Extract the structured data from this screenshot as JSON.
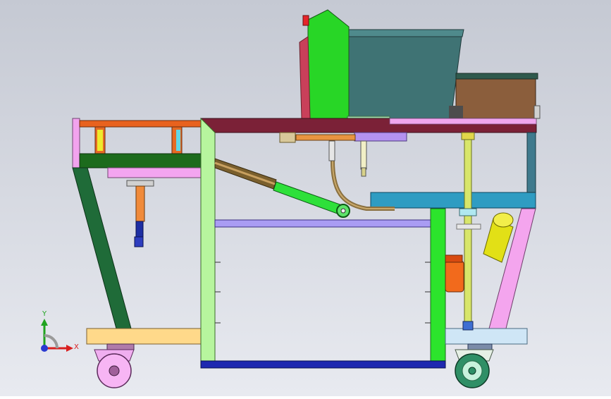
{
  "triad": {
    "x_label": "X",
    "y_label": "Y"
  },
  "colors": {
    "background_top": "#c9ccd6",
    "background_bottom": "#e4e6ed",
    "maroon_beam": "#7a1f35",
    "green_post": "#7ee27e",
    "teal_box": "#3a7e95",
    "blue_beam": "#1b2ea8",
    "pink_brace": "#f4a2e8",
    "yellow_cylinder": "#e3e21b",
    "orange_motor": "#f16a1e",
    "brown_bin": "#8a5a3c"
  }
}
